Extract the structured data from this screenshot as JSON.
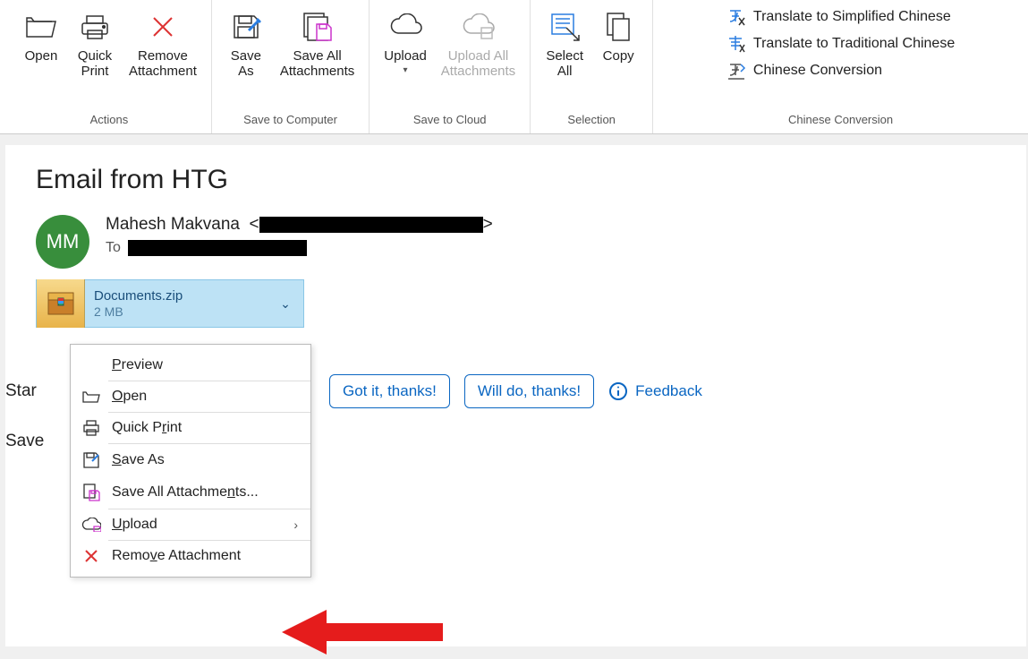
{
  "ribbon": {
    "groups": {
      "actions": {
        "label": "Actions",
        "open": "Open",
        "quick_print": "Quick\nPrint",
        "remove_attachment": "Remove\nAttachment"
      },
      "save_computer": {
        "label": "Save to Computer",
        "save_as": "Save\nAs",
        "save_all": "Save All\nAttachments"
      },
      "save_cloud": {
        "label": "Save to Cloud",
        "upload": "Upload",
        "upload_all": "Upload All\nAttachments"
      },
      "selection": {
        "label": "Selection",
        "select_all": "Select\nAll",
        "copy": "Copy"
      },
      "conversion": {
        "label": "Chinese Conversion",
        "simplified": "Translate to Simplified Chinese",
        "traditional": "Translate to Traditional Chinese",
        "conversion": "Chinese Conversion"
      }
    }
  },
  "email": {
    "subject": "Email from HTG",
    "avatar_initials": "MM",
    "from_name": "Mahesh Makvana",
    "to_label": "To",
    "attachment": {
      "name": "Documents.zip",
      "size": "2 MB"
    },
    "body_clip_start": "Star",
    "body_clip_save": "Save"
  },
  "suggest": {
    "got_it": "Got it, thanks!",
    "will_do": "Will do, thanks!",
    "feedback": "Feedback"
  },
  "context_menu": {
    "preview": "Preview",
    "open": "Open",
    "quick_print": "Quick Print",
    "save_as": "Save As",
    "save_all": "Save All Attachments...",
    "upload": "Upload",
    "remove": "Remove Attachment"
  }
}
